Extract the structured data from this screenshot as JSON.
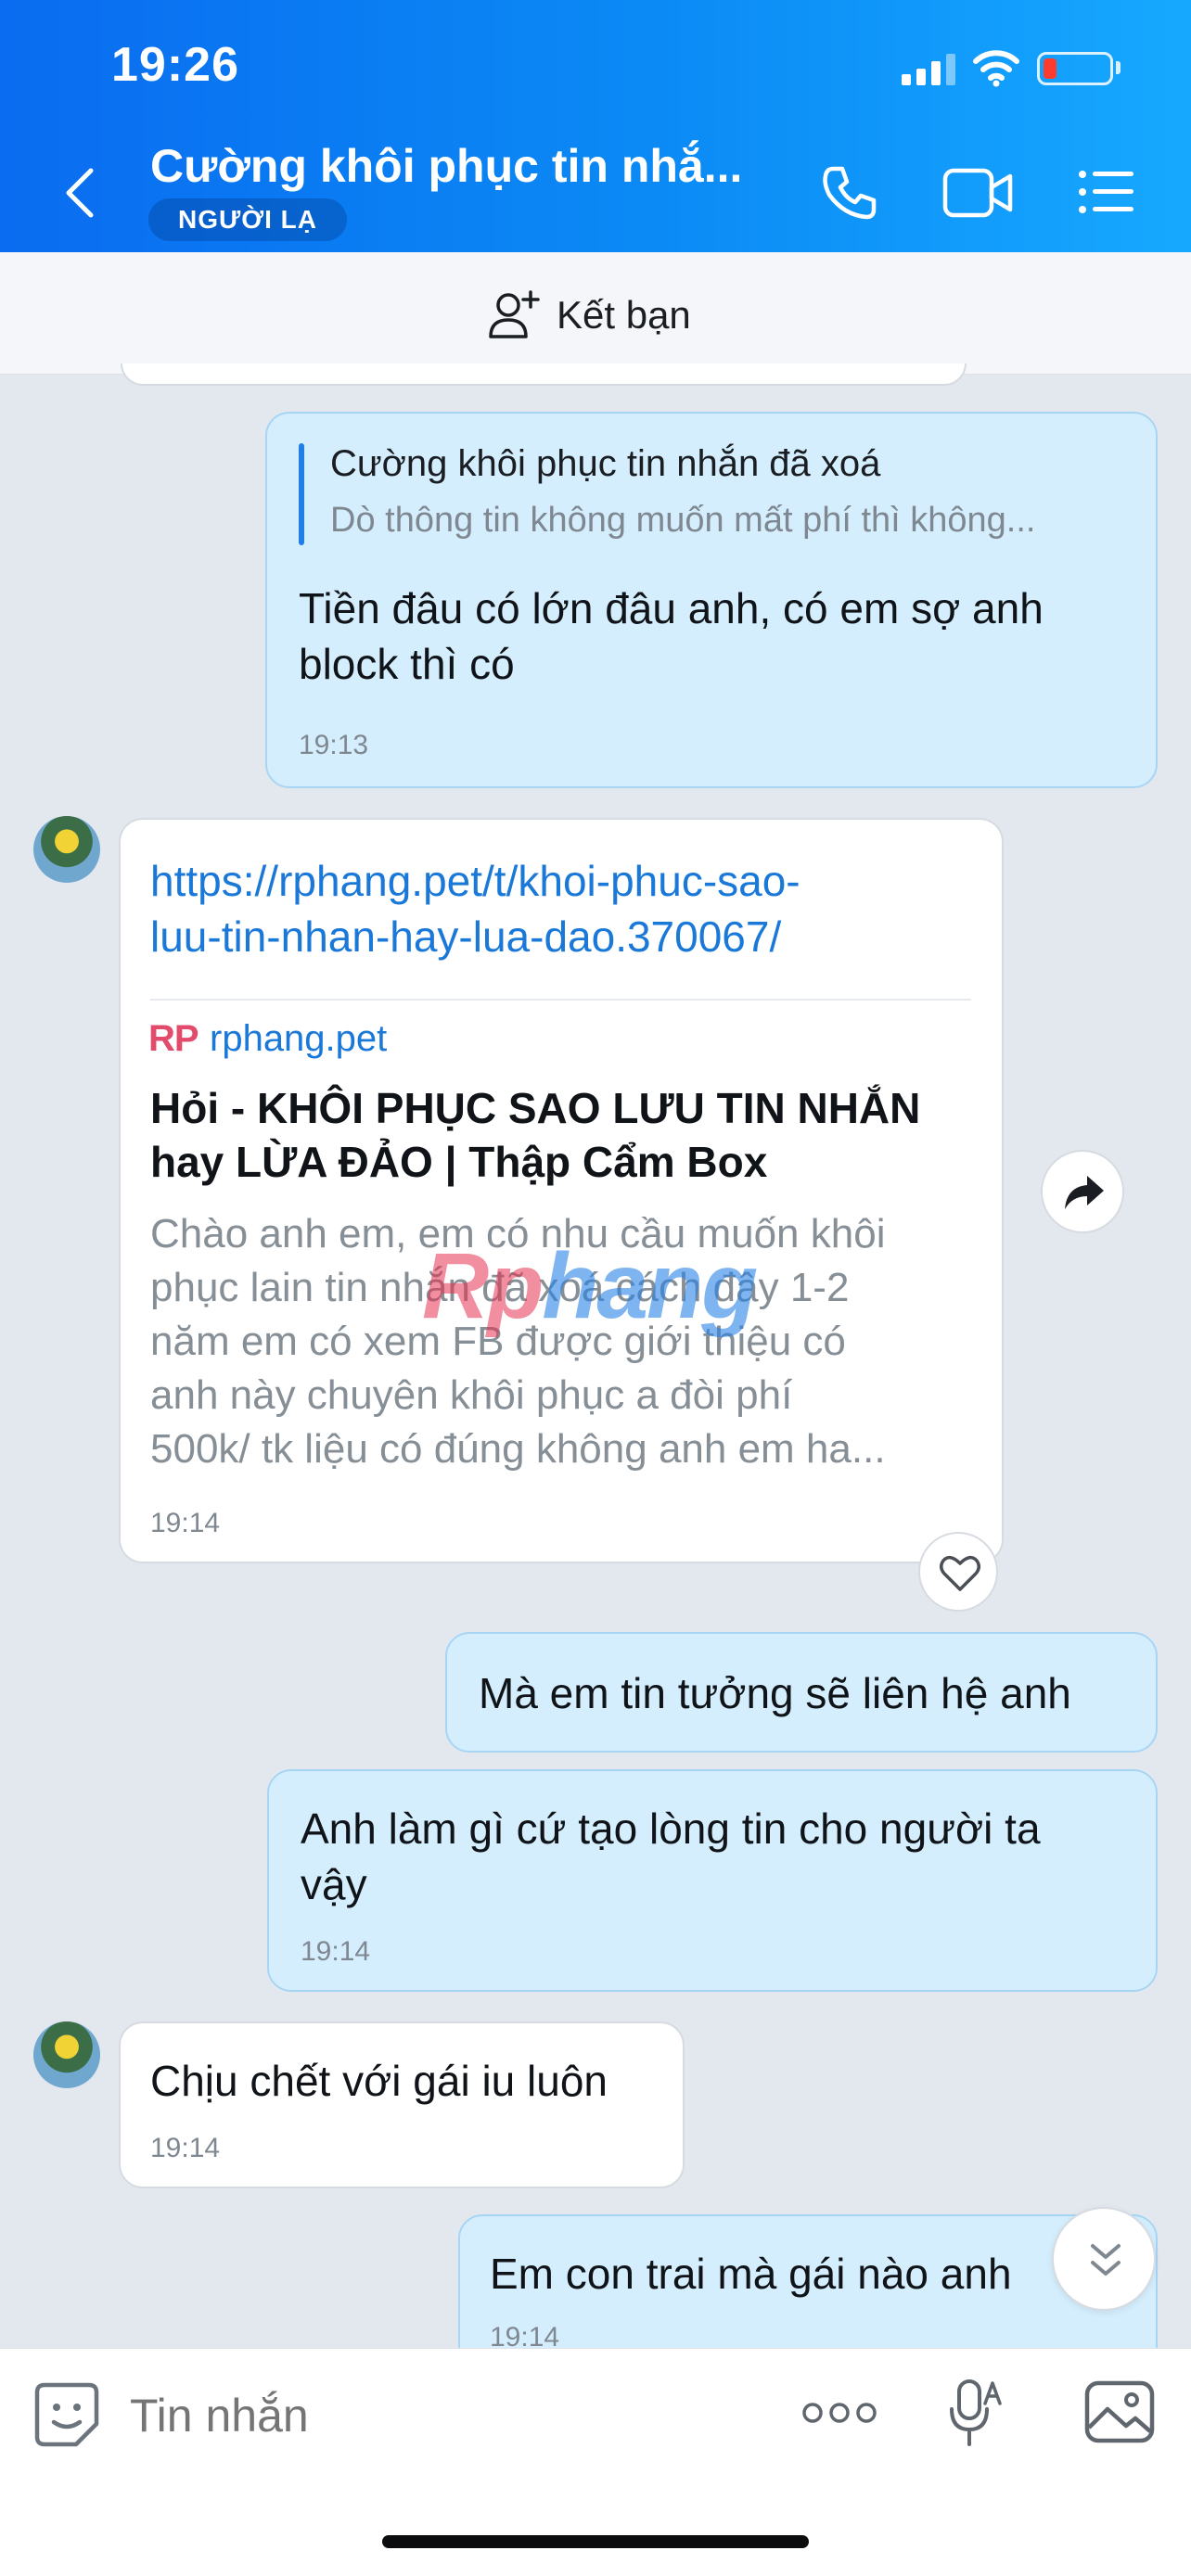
{
  "status_bar": {
    "time": "19:26"
  },
  "header": {
    "title": "Cường khôi phục tin nhắ...",
    "badge": "NGƯỜI LẠ",
    "icons": [
      "back-icon",
      "phone-icon",
      "video-call-icon",
      "menu-icon"
    ]
  },
  "friend_bar": {
    "label": "Kết bạn"
  },
  "messages": {
    "m1": {
      "quote_author": "Cường khôi phục tin nhắn đã xoá",
      "quote_text": "Dò thông tin không muốn mất phí thì không...",
      "text_line1": "Tiền đâu có lớn đâu anh, có em sợ anh",
      "text_line2": "block thì có",
      "time": "19:13"
    },
    "m2": {
      "url_line1": "https://rphang.pet/t/khoi-phuc-sao-",
      "url_line2": "luu-tin-nhan-hay-lua-dao.370067/",
      "site_logo": "RP",
      "site": "rphang.pet",
      "title_line1": "Hỏi - KHÔI PHỤC SAO LƯU TIN NHẮN",
      "title_line2": "hay LỪA ĐẢO | Thập Cẩm Box",
      "desc_line1": "Chào anh em, em có nhu cầu muốn khôi",
      "desc_line2": "phục lain tin nhắn đã xoá cách đây 1-2",
      "desc_line3": "năm em có xem FB được giới thiệu có",
      "desc_line4": "anh này chuyên khôi phục a đòi phí",
      "desc_line5": "500k/ tk liệu có đúng không anh em ha...",
      "time": "19:14"
    },
    "m3": {
      "text": "Mà em tin tưởng sẽ liên hệ anh"
    },
    "m4": {
      "text_line1": "Anh làm gì cứ tạo lòng tin cho người ta",
      "text_line2": "vậy",
      "time": "19:14"
    },
    "m5": {
      "text": "Chịu chết với gái iu luôn",
      "time": "19:14"
    },
    "m6": {
      "text": "Em con trai mà gái nào anh",
      "time": "19:14"
    }
  },
  "watermark": {
    "part1": "Rp",
    "part2": "hang"
  },
  "input_bar": {
    "placeholder": "Tin nhắn"
  },
  "colors": {
    "header_start": "#0a6cf0",
    "header_end": "#16a8ff",
    "link": "#1a78d8",
    "outgoing_bubble": "#d4eefe"
  }
}
